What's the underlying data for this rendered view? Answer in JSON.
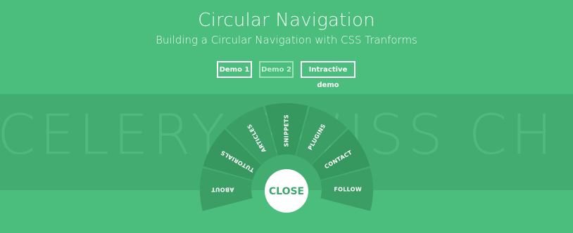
{
  "header": {
    "title": "Circular Navigation",
    "subtitle": "Building a Circular Navigation with CSS Tranforms"
  },
  "demos": [
    {
      "label": "Demo 1",
      "active": true
    },
    {
      "label": "Demo 2",
      "active": false
    },
    {
      "label": "Intractive demo",
      "active": true
    }
  ],
  "background_text": "CELERY SWISS CH",
  "menu": {
    "items": [
      {
        "label": "ABOUT"
      },
      {
        "label": "TUTORIALS"
      },
      {
        "label": "ARTICLES"
      },
      {
        "label": "SNIPPETS"
      },
      {
        "label": "PLUGINS"
      },
      {
        "label": "CONTACT"
      },
      {
        "label": "FOLLOW"
      }
    ],
    "close_label": "CLOSE"
  },
  "colors": {
    "background": "#4bbd7c",
    "band": "#43ad71",
    "segment": "#3a9e65",
    "segment_alt": "#37985f",
    "close_button": "#ffffff"
  }
}
